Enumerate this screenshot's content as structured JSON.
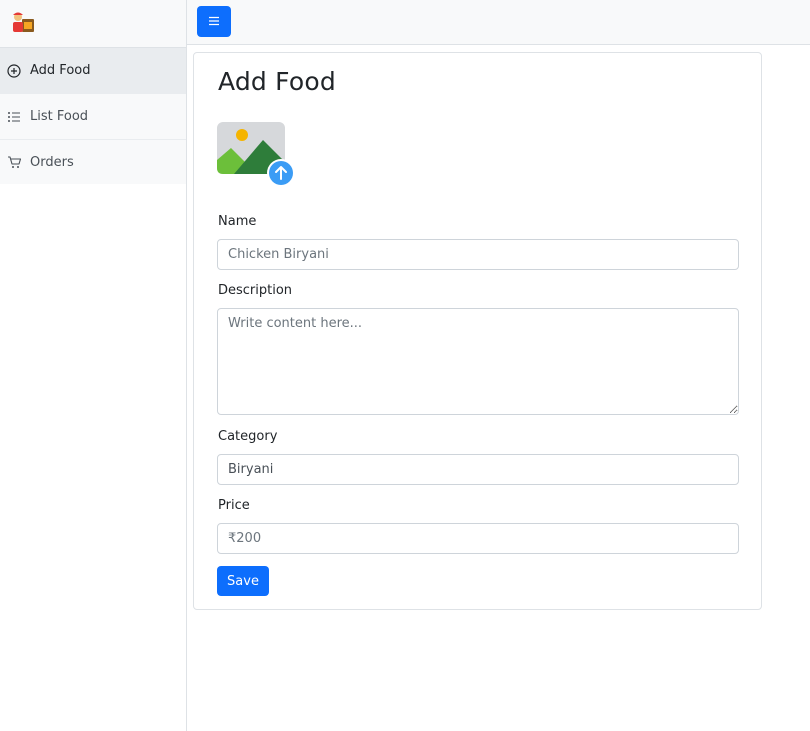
{
  "sidebar": {
    "logo": "food-delivery-logo",
    "items": [
      {
        "label": "Add Food",
        "icon": "plus-circle-icon",
        "active": true
      },
      {
        "label": "List Food",
        "icon": "list-icon",
        "active": false
      },
      {
        "label": "Orders",
        "icon": "cart-icon",
        "active": false
      }
    ]
  },
  "topbar": {
    "toggle_icon": "hamburger-menu-icon"
  },
  "form": {
    "title": "Add Food",
    "upload_icon": "image-upload-icon",
    "name_label": "Name",
    "name_placeholder": "Chicken Biryani",
    "description_label": "Description",
    "description_placeholder": "Write content here...",
    "category_label": "Category",
    "category_value": "Biryani",
    "price_label": "Price",
    "price_placeholder": "₹200",
    "save_label": "Save"
  },
  "colors": {
    "primary": "#0d6efd",
    "upload_badge": "#3b9cf5"
  }
}
